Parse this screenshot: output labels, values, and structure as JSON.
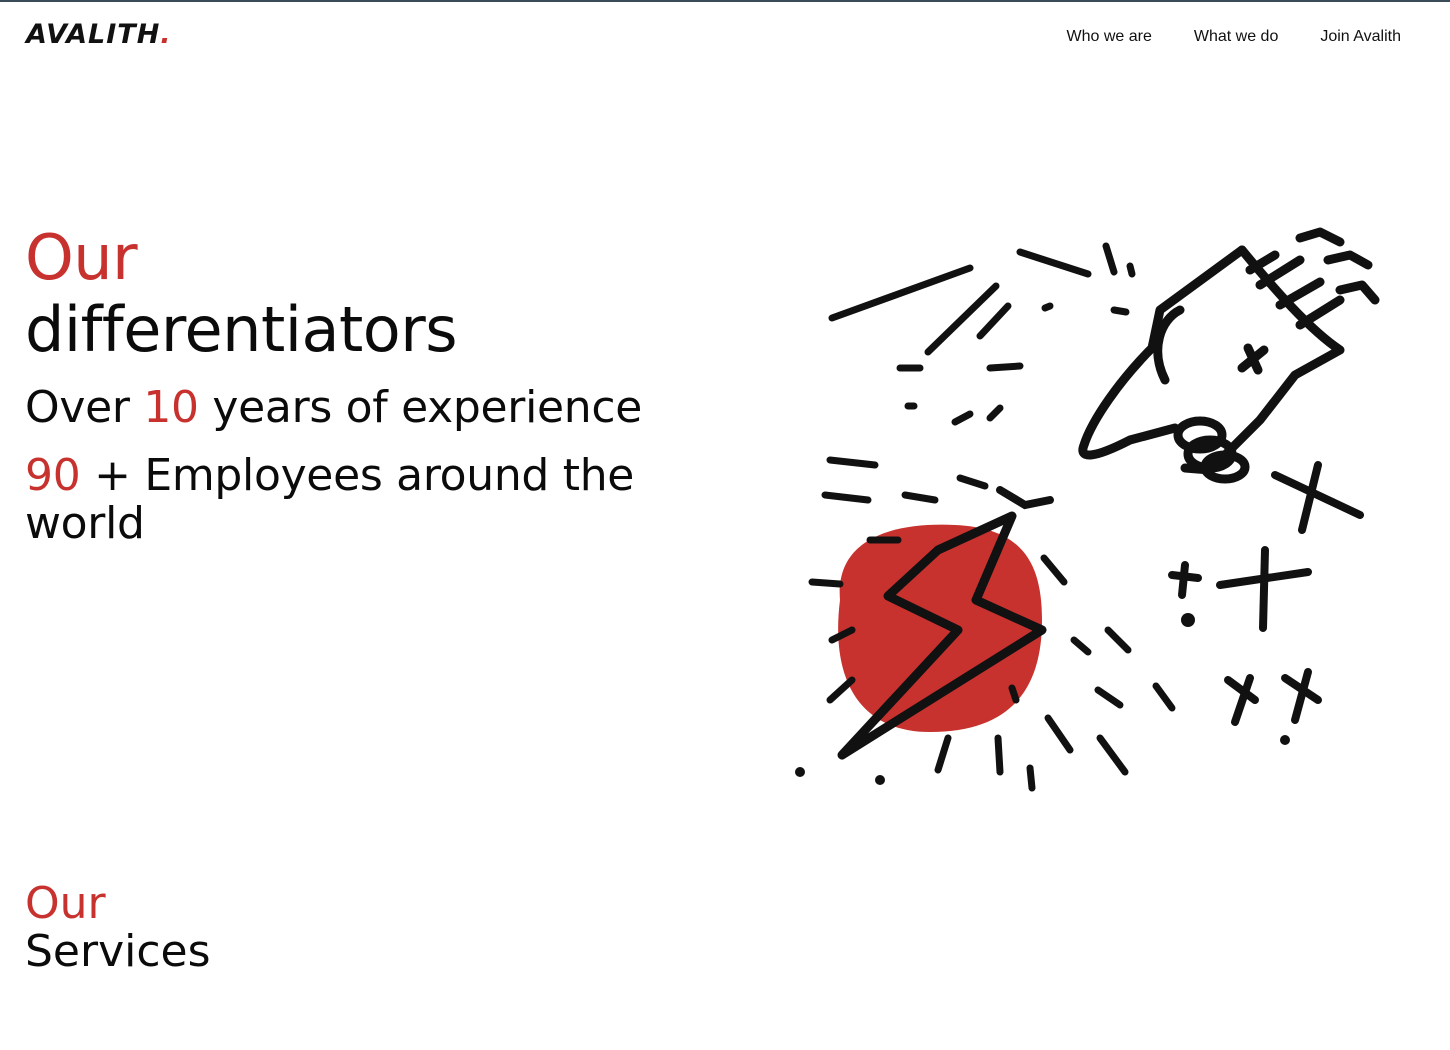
{
  "header": {
    "logo_text": "AVALITH",
    "logo_dot": ".",
    "nav": [
      {
        "label": "Who we are"
      },
      {
        "label": "What we do"
      },
      {
        "label": "Join Avalith"
      }
    ]
  },
  "hero": {
    "title_accent": "Our",
    "title_rest": "differentiators",
    "stat1": {
      "prefix": "Over ",
      "number": "10",
      "suffix": " years of experience"
    },
    "stat2": {
      "number": "90",
      "suffix": " + Employees around the world"
    }
  },
  "illustration": {
    "icon": "lightning-hand-illustration",
    "accent_color": "#c7322f"
  },
  "services": {
    "title_accent": "Our",
    "title_rest": "Services"
  },
  "colors": {
    "accent": "#c7322f",
    "text": "#0b0b0b",
    "background": "#ffffff"
  }
}
